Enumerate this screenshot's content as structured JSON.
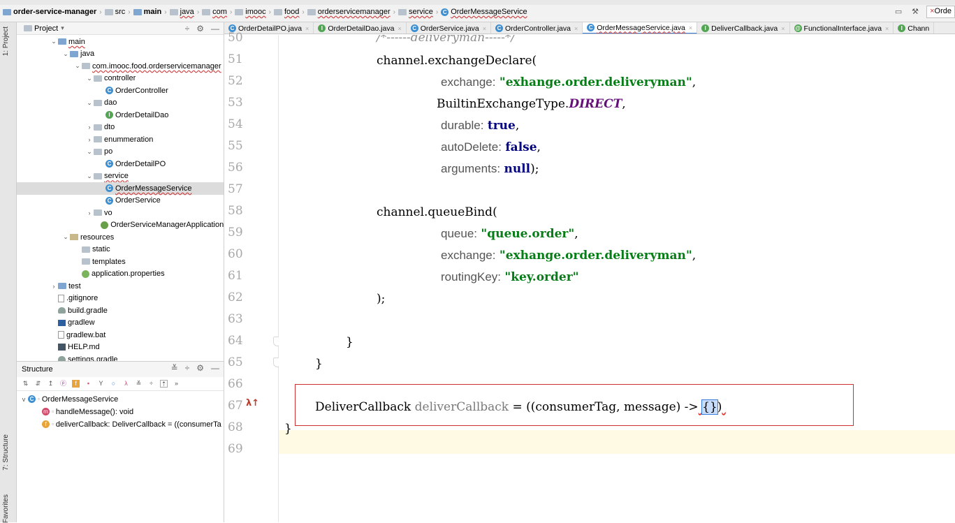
{
  "navbar": {
    "crumbs": [
      {
        "label": "order-service-manager",
        "bold": true
      },
      {
        "label": "src"
      },
      {
        "label": "main",
        "bold": true
      },
      {
        "label": "java"
      },
      {
        "label": "com"
      },
      {
        "label": "imooc"
      },
      {
        "label": "food"
      },
      {
        "label": "orderservicemanager"
      },
      {
        "label": "service"
      },
      {
        "label": "OrderMessageService"
      }
    ],
    "run_config": "Orde"
  },
  "left_strip": {
    "project_tab": "1: Project",
    "structure_tab": "7: Structure",
    "favorites_tab": "Favorites"
  },
  "project": {
    "title": "Project",
    "tree": [
      {
        "label": "main",
        "indent": 1,
        "arrow": "v",
        "icon": "folder-mod"
      },
      {
        "label": "java",
        "indent": 2,
        "arrow": "v",
        "icon": "folder-mod"
      },
      {
        "label": "com.imooc.food.orderservicemanager",
        "indent": 3,
        "arrow": "v",
        "icon": "folder"
      },
      {
        "label": "controller",
        "indent": 4,
        "arrow": "v",
        "icon": "folder"
      },
      {
        "label": "OrderController",
        "indent": 5,
        "arrow": "",
        "icon": "class"
      },
      {
        "label": "dao",
        "indent": 4,
        "arrow": "v",
        "icon": "folder"
      },
      {
        "label": "OrderDetailDao",
        "indent": 5,
        "arrow": "",
        "icon": "iface"
      },
      {
        "label": "dto",
        "indent": 4,
        "arrow": ">",
        "icon": "folder"
      },
      {
        "label": "enummeration",
        "indent": 4,
        "arrow": ">",
        "icon": "folder"
      },
      {
        "label": "po",
        "indent": 4,
        "arrow": "v",
        "icon": "folder"
      },
      {
        "label": "OrderDetailPO",
        "indent": 5,
        "arrow": "",
        "icon": "class"
      },
      {
        "label": "service",
        "indent": 4,
        "arrow": "v",
        "icon": "folder"
      },
      {
        "label": "OrderMessageService",
        "indent": 5,
        "arrow": "",
        "icon": "class",
        "selected": true
      },
      {
        "label": "OrderService",
        "indent": 5,
        "arrow": "",
        "icon": "class"
      },
      {
        "label": "vo",
        "indent": 4,
        "arrow": ">",
        "icon": "folder"
      },
      {
        "label": "OrderServiceManagerApplication",
        "indent": 4.6,
        "arrow": "",
        "icon": "spring"
      },
      {
        "label": "resources",
        "indent": 2,
        "arrow": "v",
        "icon": "res"
      },
      {
        "label": "static",
        "indent": 3,
        "arrow": "",
        "icon": "folder"
      },
      {
        "label": "templates",
        "indent": 3,
        "arrow": "",
        "icon": "folder"
      },
      {
        "label": "application.properties",
        "indent": 3,
        "arrow": "",
        "icon": "props"
      },
      {
        "label": "test",
        "indent": 1,
        "arrow": ">",
        "icon": "folder-mod"
      },
      {
        "label": ".gitignore",
        "indent": 1,
        "arrow": "",
        "icon": "file"
      },
      {
        "label": "build.gradle",
        "indent": 1,
        "arrow": "",
        "icon": "gradle"
      },
      {
        "label": "gradlew",
        "indent": 1,
        "arrow": "",
        "icon": "term"
      },
      {
        "label": "gradlew.bat",
        "indent": 1,
        "arrow": "",
        "icon": "file"
      },
      {
        "label": "HELP.md",
        "indent": 1,
        "arrow": "",
        "icon": "md"
      },
      {
        "label": "settings.gradle",
        "indent": 1,
        "arrow": "",
        "icon": "gradle"
      }
    ]
  },
  "structure": {
    "title": "Structure",
    "root": "OrderMessageService",
    "members": [
      {
        "label": "handleMessage(): void",
        "icon": "m"
      },
      {
        "label": "deliverCallback: DeliverCallback = ((consumerTa",
        "icon": "f"
      }
    ]
  },
  "tabs": [
    {
      "label": "OrderDetailPO.java",
      "icon": "class"
    },
    {
      "label": "OrderDetailDao.java",
      "icon": "iface"
    },
    {
      "label": "OrderService.java",
      "icon": "class"
    },
    {
      "label": "OrderController.java",
      "icon": "class"
    },
    {
      "label": "OrderMessageService.java",
      "icon": "class",
      "active": true
    },
    {
      "label": "DeliverCallback.java",
      "icon": "iface"
    },
    {
      "label": "FunctionalInterface.java",
      "icon": "anno"
    },
    {
      "label": "Chann",
      "icon": "iface"
    }
  ],
  "editor": {
    "line_numbers": [
      "50",
      "51",
      "52",
      "53",
      "54",
      "55",
      "56",
      "57",
      "58",
      "59",
      "60",
      "61",
      "62",
      "63",
      "64",
      "65",
      "66",
      "67",
      "68",
      "69"
    ],
    "lambda_marker": "λ↑",
    "code": {
      "l50": "/*------deliveryman-----*/",
      "l51": "channel.exchangeDeclare(",
      "l52_hint": "exchange:",
      "l52_val": "\"exhange.order.deliveryman\"",
      "l52_end": ",",
      "l53_a": "BuiltinExchangeType.",
      "l53_b": "DIRECT",
      "l53_c": ",",
      "l54_hint": "durable:",
      "l54_val": "true",
      "l54_end": ",",
      "l55_hint": "autoDelete:",
      "l55_val": "false",
      "l55_end": ",",
      "l56_hint": "arguments:",
      "l56_val": "null",
      "l56_end": ");",
      "l58": "channel.queueBind(",
      "l59_hint": "queue:",
      "l59_val": "\"queue.order\"",
      "l59_end": ",",
      "l60_hint": "exchange:",
      "l60_val": "\"exhange.order.deliveryman\"",
      "l60_end": ",",
      "l61_hint": "routingKey:",
      "l61_val": "\"key.order\"",
      "l62": ");",
      "l64": "}",
      "l65": "}",
      "l67_type": "DeliverCallback",
      "l67_name": "deliverCallback",
      "l67_mid": " = ((consumerTag, message) ->",
      "l67_brace": "{}",
      "l67_end": ")",
      "l68": "}"
    }
  }
}
